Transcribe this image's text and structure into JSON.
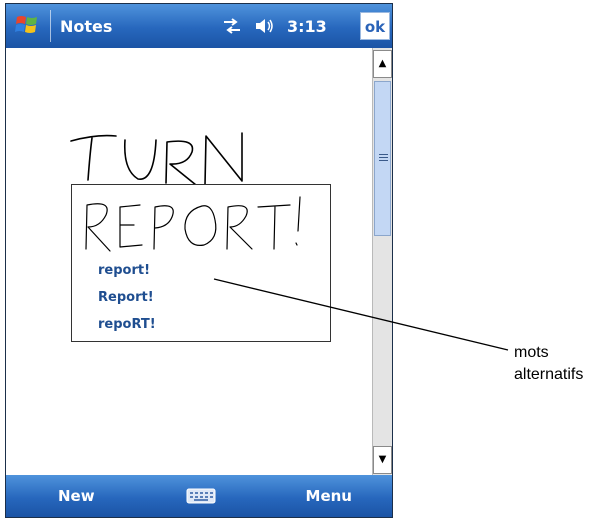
{
  "titlebar": {
    "app_title": "Notes",
    "time": "3:13",
    "ok_label": "ok",
    "icons": [
      "windows-start-icon",
      "connectivity-icon",
      "volume-icon"
    ]
  },
  "canvas": {
    "handwritten_words": [
      "TURN",
      "REPORT!"
    ]
  },
  "alternates": {
    "items": [
      "report!",
      "Report!",
      "repoRT!"
    ]
  },
  "menubar": {
    "left_label": "New",
    "right_label": "Menu",
    "icons": [
      "keyboard-icon"
    ]
  },
  "callout": {
    "line1": "mots",
    "line2": "alternatifs"
  },
  "colors": {
    "bar_blue": "#2767bd",
    "link_blue": "#1f4e90"
  }
}
